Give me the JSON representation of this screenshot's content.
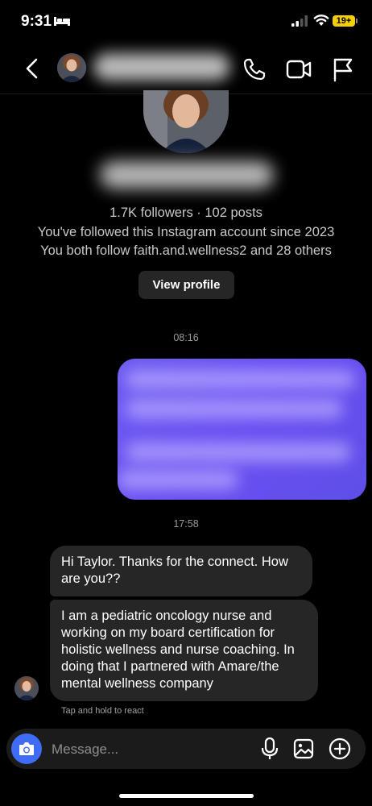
{
  "status_bar": {
    "time": "9:31",
    "battery": "19+"
  },
  "header": {
    "back_icon": "chevron-left-icon",
    "call_icon": "phone-icon",
    "video_icon": "video-icon",
    "flag_icon": "flag-icon"
  },
  "profile": {
    "stats": "1.7K followers · 102 posts",
    "followed_since": "You've followed this Instagram account since 2023",
    "mutuals": "You both follow faith.and.wellness2 and 28 others",
    "view_profile_label": "View profile"
  },
  "thread": {
    "timestamp_1": "08:16",
    "timestamp_2": "17:58",
    "incoming_1": "Hi Taylor. Thanks for the connect. How are you??",
    "incoming_2": "I am a pediatric oncology nurse and working on my board certification for holistic wellness and nurse coaching. In doing that I partnered with Amare/the mental wellness company",
    "react_hint": "Tap and hold to react"
  },
  "composer": {
    "placeholder": "Message..."
  },
  "colors": {
    "accent": "#3f6cf6",
    "outgoing_bubble": "#6a4ff2",
    "incoming_bubble": "#262626",
    "battery": "#f5d000"
  }
}
